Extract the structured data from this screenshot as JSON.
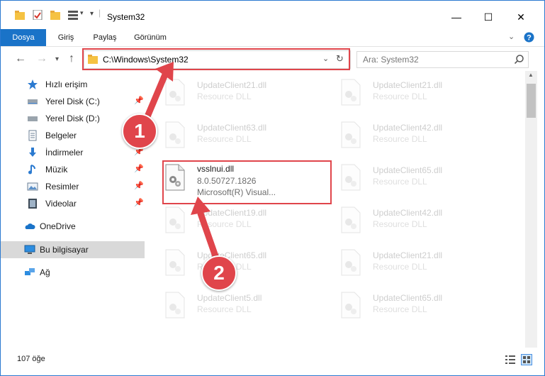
{
  "window": {
    "title": "System32"
  },
  "ribbon": {
    "tabs": [
      "Dosya",
      "Giriş",
      "Paylaş",
      "Görünüm"
    ]
  },
  "address": {
    "path": "C:\\Windows\\System32"
  },
  "search": {
    "placeholder": "Ara: System32"
  },
  "sidebar": {
    "items": [
      {
        "label": "Hızlı erişim",
        "icon": "star-icon",
        "pinned": false
      },
      {
        "label": "Yerel Disk (C:)",
        "icon": "drive-icon",
        "pinned": true
      },
      {
        "label": "Yerel Disk (D:)",
        "icon": "drive-icon",
        "pinned": false
      },
      {
        "label": "Belgeler",
        "icon": "document-icon",
        "pinned": true
      },
      {
        "label": "İndirmeler",
        "icon": "download-icon",
        "pinned": true
      },
      {
        "label": "Müzik",
        "icon": "music-icon",
        "pinned": true
      },
      {
        "label": "Resimler",
        "icon": "pictures-icon",
        "pinned": true
      },
      {
        "label": "Videolar",
        "icon": "video-icon",
        "pinned": true
      },
      {
        "label": "OneDrive",
        "icon": "cloud-icon",
        "pinned": false
      },
      {
        "label": "Bu bilgisayar",
        "icon": "computer-icon",
        "pinned": false,
        "selected": true
      },
      {
        "label": "Ağ",
        "icon": "network-icon",
        "pinned": false
      }
    ]
  },
  "files": [
    {
      "name": "UpdateClient21.dll",
      "type": "Resource DLL",
      "faded": true
    },
    {
      "name": "UpdateClient21.dll",
      "type": "Resource DLL",
      "faded": true
    },
    {
      "name": "UpdateClient63.dll",
      "type": "Resource DLL",
      "faded": true
    },
    {
      "name": "UpdateClient42.dll",
      "type": "Resource DLL",
      "faded": true
    },
    {
      "name": "vsslnui.dll",
      "version": "8.0.50727.1826",
      "company": "Microsoft(R) Visual...",
      "faded": false
    },
    {
      "name": "UpdateClient65.dll",
      "type": "Resource DLL",
      "faded": true
    },
    {
      "name": "UpdateClient19.dll",
      "type": "Resource DLL",
      "faded": true
    },
    {
      "name": "UpdateClient42.dll",
      "type": "Resource DLL",
      "faded": true
    },
    {
      "name": "UpdateClient65.dll",
      "type": "Resource DLL",
      "faded": true
    },
    {
      "name": "UpdateClient21.dll",
      "type": "Resource DLL",
      "faded": true
    },
    {
      "name": "UpdateClient5.dll",
      "type": "Resource DLL",
      "faded": true
    },
    {
      "name": "UpdateClient65.dll",
      "type": "Resource DLL",
      "faded": true
    }
  ],
  "status": {
    "count": "107 öğe"
  },
  "callouts": [
    "1",
    "2"
  ],
  "colors": {
    "accent": "#1a73c8",
    "highlight": "#e0454b"
  }
}
